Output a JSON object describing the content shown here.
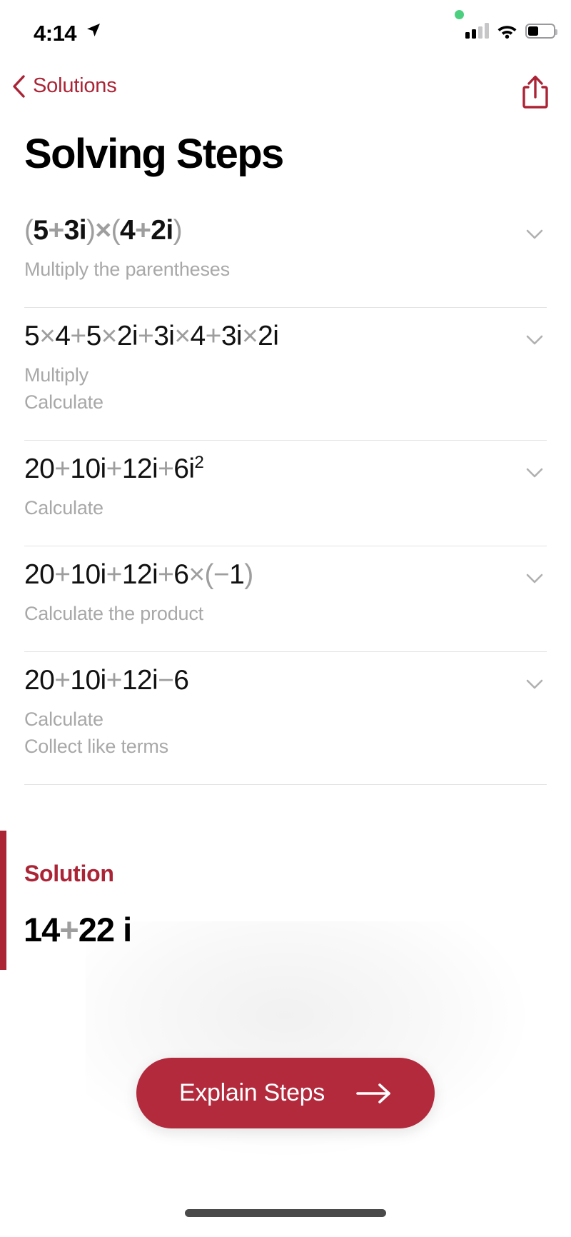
{
  "status_bar": {
    "time": "4:14",
    "location_icon": "location-arrow-icon",
    "recording_icon": "green-recording-dot",
    "cellular_icon": "cellular-signal-icon",
    "wifi_icon": "wifi-icon",
    "battery_icon": "battery-icon",
    "battery_level_percent": 42
  },
  "nav": {
    "back_label": "Solutions",
    "back_icon": "chevron-left-icon",
    "share_icon": "share-icon",
    "accent_color": "#ab2436"
  },
  "header": {
    "title": "Solving Steps"
  },
  "steps": [
    {
      "expression_parts": [
        {
          "t": "(",
          "k": "paren"
        },
        {
          "t": "5",
          "k": "num"
        },
        {
          "t": "+",
          "k": "op"
        },
        {
          "t": "3i",
          "k": "num"
        },
        {
          "t": ")",
          "k": "paren"
        },
        {
          "t": "×",
          "k": "op"
        },
        {
          "t": "(",
          "k": "paren"
        },
        {
          "t": "4",
          "k": "num"
        },
        {
          "t": "+",
          "k": "op"
        },
        {
          "t": "2i",
          "k": "num"
        },
        {
          "t": ")",
          "k": "paren"
        }
      ],
      "expression_text": "(5+3i)×(4+2i)",
      "bold": true,
      "hints": [
        "Multiply the parentheses"
      ],
      "expand_icon": "chevron-down-icon"
    },
    {
      "expression_parts": [
        {
          "t": "5",
          "k": "num"
        },
        {
          "t": "×",
          "k": "op"
        },
        {
          "t": "4",
          "k": "num"
        },
        {
          "t": "+",
          "k": "op"
        },
        {
          "t": "5",
          "k": "num"
        },
        {
          "t": "×",
          "k": "op"
        },
        {
          "t": "2i",
          "k": "num"
        },
        {
          "t": "+",
          "k": "op"
        },
        {
          "t": "3i",
          "k": "num"
        },
        {
          "t": "×",
          "k": "op"
        },
        {
          "t": "4",
          "k": "num"
        },
        {
          "t": "+",
          "k": "op"
        },
        {
          "t": "3i",
          "k": "num"
        },
        {
          "t": "×",
          "k": "op"
        },
        {
          "t": "2i",
          "k": "num"
        }
      ],
      "expression_text": "5×4+5×2i+3i×4+3i×2i",
      "bold": false,
      "hints": [
        "Multiply",
        "Calculate"
      ],
      "expand_icon": "chevron-down-icon"
    },
    {
      "expression_parts": [
        {
          "t": "20",
          "k": "num"
        },
        {
          "t": "+",
          "k": "op"
        },
        {
          "t": "10i",
          "k": "num"
        },
        {
          "t": "+",
          "k": "op"
        },
        {
          "t": "12i",
          "k": "num"
        },
        {
          "t": "+",
          "k": "op"
        },
        {
          "t": "6i",
          "k": "num"
        },
        {
          "t": "2",
          "k": "sup"
        }
      ],
      "expression_text": "20+10i+12i+6i²",
      "bold": false,
      "hints": [
        "Calculate"
      ],
      "expand_icon": "chevron-down-icon"
    },
    {
      "expression_parts": [
        {
          "t": "20",
          "k": "num"
        },
        {
          "t": "+",
          "k": "op"
        },
        {
          "t": "10i",
          "k": "num"
        },
        {
          "t": "+",
          "k": "op"
        },
        {
          "t": "12i",
          "k": "num"
        },
        {
          "t": "+",
          "k": "op"
        },
        {
          "t": "6",
          "k": "num"
        },
        {
          "t": "×",
          "k": "op"
        },
        {
          "t": "(",
          "k": "paren"
        },
        {
          "t": "−",
          "k": "op"
        },
        {
          "t": "1",
          "k": "num"
        },
        {
          "t": ")",
          "k": "paren"
        }
      ],
      "expression_text": "20+10i+12i+6×(−1)",
      "bold": false,
      "hints": [
        "Calculate the product"
      ],
      "expand_icon": "chevron-down-icon"
    },
    {
      "expression_parts": [
        {
          "t": "20",
          "k": "num"
        },
        {
          "t": "+",
          "k": "op"
        },
        {
          "t": "10i",
          "k": "num"
        },
        {
          "t": "+",
          "k": "op"
        },
        {
          "t": "12i",
          "k": "num"
        },
        {
          "t": "−",
          "k": "op"
        },
        {
          "t": "6",
          "k": "num"
        }
      ],
      "expression_text": "20+10i+12i−6",
      "bold": false,
      "hints": [
        "Calculate",
        "Collect like terms"
      ],
      "expand_icon": "chevron-down-icon"
    }
  ],
  "solution": {
    "label": "Solution",
    "value_parts": [
      {
        "t": "14",
        "k": "num"
      },
      {
        "t": "+",
        "k": "op"
      },
      {
        "t": "22 i",
        "k": "num"
      }
    ],
    "value_text": "14+22i",
    "accent_color": "#ab2436"
  },
  "explain_button": {
    "label": "Explain Steps",
    "icon": "arrow-right-icon",
    "background_color": "#b22a3c"
  },
  "home_indicator": "home-indicator"
}
